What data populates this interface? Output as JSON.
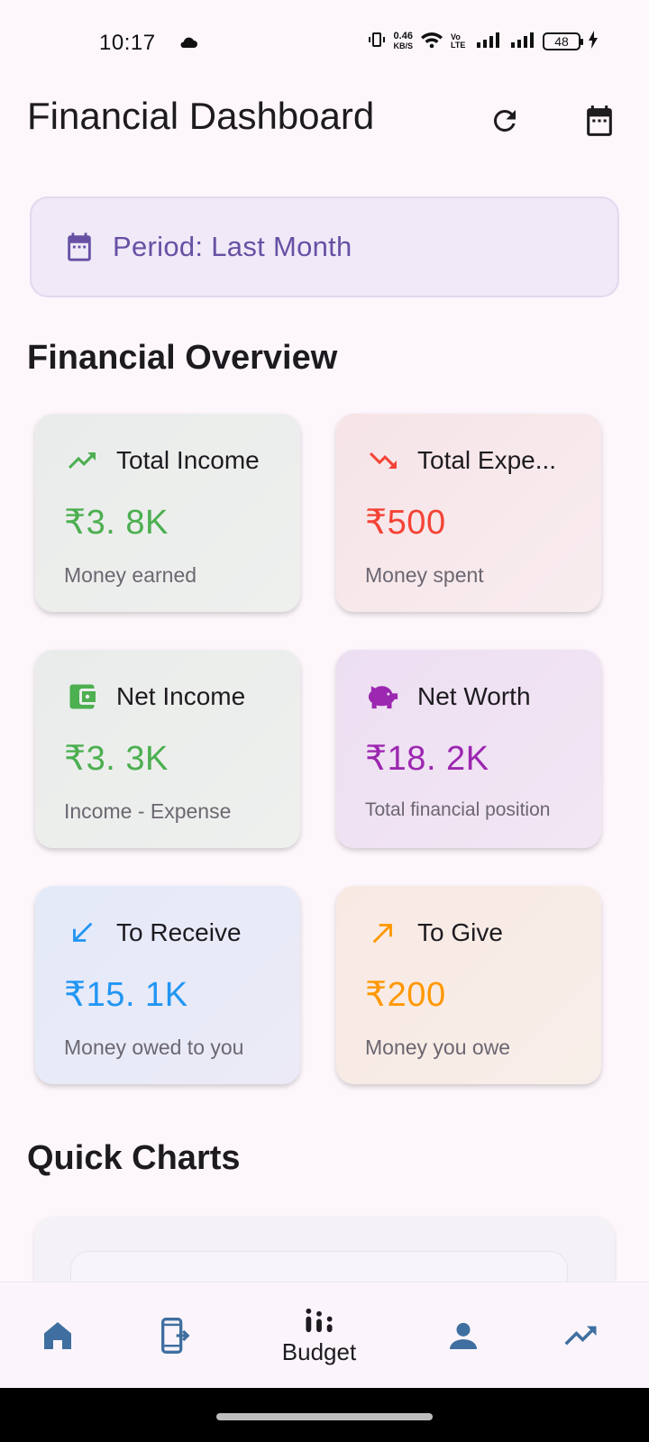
{
  "status_bar": {
    "time": "10:17",
    "net_speed_top": "0.46",
    "net_speed_bottom": "KB/S",
    "volte": "Vo LTE",
    "battery": "48"
  },
  "header": {
    "title": "Financial Dashboard",
    "refresh_icon": "refresh-icon",
    "calendar_icon": "calendar-icon"
  },
  "period": {
    "text": "Period: Last Month"
  },
  "overview": {
    "title": "Financial Overview",
    "cards": [
      {
        "label": "Total Income",
        "value": "₹3. 8K",
        "sub": "Money earned",
        "icon": "trending-up-icon",
        "color": "#4caf50"
      },
      {
        "label": "Total Expe...",
        "value": "₹500",
        "sub": "Money spent",
        "icon": "trending-down-icon",
        "color": "#f44336"
      },
      {
        "label": "Net Income",
        "value": "₹3. 3K",
        "sub": "Income - Expense",
        "icon": "wallet-icon",
        "color": "#4caf50"
      },
      {
        "label": "Net Worth",
        "value": "₹18. 2K",
        "sub": "Total financial position",
        "icon": "piggy-bank-icon",
        "color": "#9c27b0"
      },
      {
        "label": "To Receive",
        "value": "₹15. 1K",
        "sub": "Money owed to you",
        "icon": "arrow-down-left-icon",
        "color": "#2196f3"
      },
      {
        "label": "To Give",
        "value": "₹200",
        "sub": "Money you owe",
        "icon": "arrow-up-right-icon",
        "color": "#ff9800"
      }
    ]
  },
  "quick_charts": {
    "title": "Quick Charts"
  },
  "bottom_nav": {
    "items": [
      {
        "label": "",
        "icon": "home-icon"
      },
      {
        "label": "",
        "icon": "transfer-icon"
      },
      {
        "label": "Budget",
        "icon": "budget-icon"
      },
      {
        "label": "",
        "icon": "person-icon"
      },
      {
        "label": "",
        "icon": "trending-icon"
      }
    ],
    "nav_color": "#3f6fa0"
  }
}
